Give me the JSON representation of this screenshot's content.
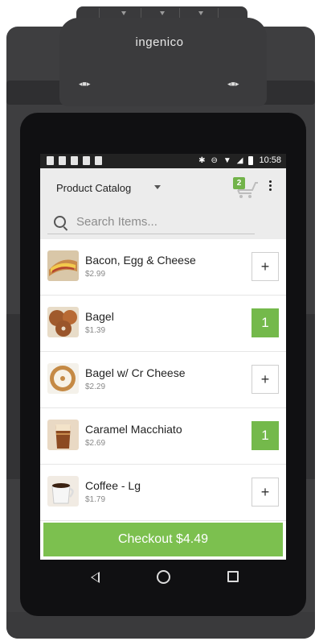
{
  "device": {
    "brand": "ingenico"
  },
  "statusbar": {
    "time": "10:58"
  },
  "appbar": {
    "catalog_label": "Product Catalog",
    "cart_count": "2"
  },
  "search": {
    "placeholder": "Search Items..."
  },
  "items": [
    {
      "name": "Bacon, Egg & Cheese",
      "price": "$2.99",
      "qty": "+"
    },
    {
      "name": "Bagel",
      "price": "$1.39",
      "qty": "1"
    },
    {
      "name": "Bagel w/ Cr Cheese",
      "price": "$2.29",
      "qty": "+"
    },
    {
      "name": "Caramel Macchiato",
      "price": "$2.69",
      "qty": "1"
    },
    {
      "name": "Coffee - Lg",
      "price": "$1.79",
      "qty": "+"
    }
  ],
  "checkout": {
    "label": "Checkout $4.49"
  },
  "colors": {
    "accent": "#74b94b",
    "checkout": "#7cc04f"
  }
}
